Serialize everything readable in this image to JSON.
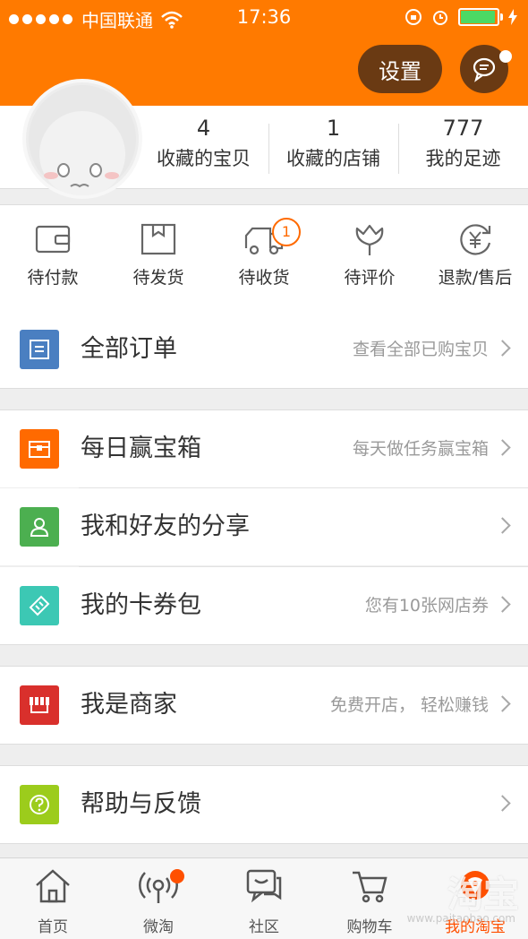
{
  "status_bar": {
    "carrier": "中国联通",
    "time": "17:36"
  },
  "header": {
    "settings_label": "设置"
  },
  "stats": [
    {
      "value": "4",
      "label": "收藏的宝贝"
    },
    {
      "value": "1",
      "label": "收藏的店铺"
    },
    {
      "value": "777",
      "label": "我的足迹"
    }
  ],
  "orders": [
    {
      "label": "待付款",
      "icon": "wallet-icon"
    },
    {
      "label": "待发货",
      "icon": "box-icon"
    },
    {
      "label": "待收货",
      "icon": "truck-icon",
      "badge": "1"
    },
    {
      "label": "待评价",
      "icon": "flower-icon"
    },
    {
      "label": "退款/售后",
      "icon": "refund-icon"
    }
  ],
  "menu": {
    "all_orders": {
      "title": "全部订单",
      "subtitle": "查看全部已购宝贝",
      "color": "#4a7fc1"
    },
    "daily_box": {
      "title": "每日赢宝箱",
      "subtitle": "每天做任务赢宝箱",
      "color": "#ff6a00"
    },
    "share": {
      "title": "我和好友的分享",
      "subtitle": "",
      "color": "#4caf50"
    },
    "coupons": {
      "title": "我的卡券包",
      "subtitle": "您有10张网店券",
      "color": "#3cc8b4"
    },
    "merchant": {
      "title": "我是商家",
      "subtitle": "免费开店，  轻松赚钱",
      "color": "#d9302c"
    },
    "help": {
      "title": "帮助与反馈",
      "subtitle": "",
      "color": "#9ccc1c"
    }
  },
  "tabbar": [
    {
      "label": "首页",
      "icon": "home-icon"
    },
    {
      "label": "微淘",
      "icon": "broadcast-icon"
    },
    {
      "label": "社区",
      "icon": "chat-icon"
    },
    {
      "label": "购物车",
      "icon": "cart-icon"
    },
    {
      "label": "我的淘宝",
      "icon": "taobao-icon",
      "active": true
    }
  ],
  "watermark": {
    "text": "淘宝",
    "url": "www.paitaobao.com"
  },
  "colors": {
    "brand": "#ff7a00",
    "accent": "#ff5000"
  }
}
